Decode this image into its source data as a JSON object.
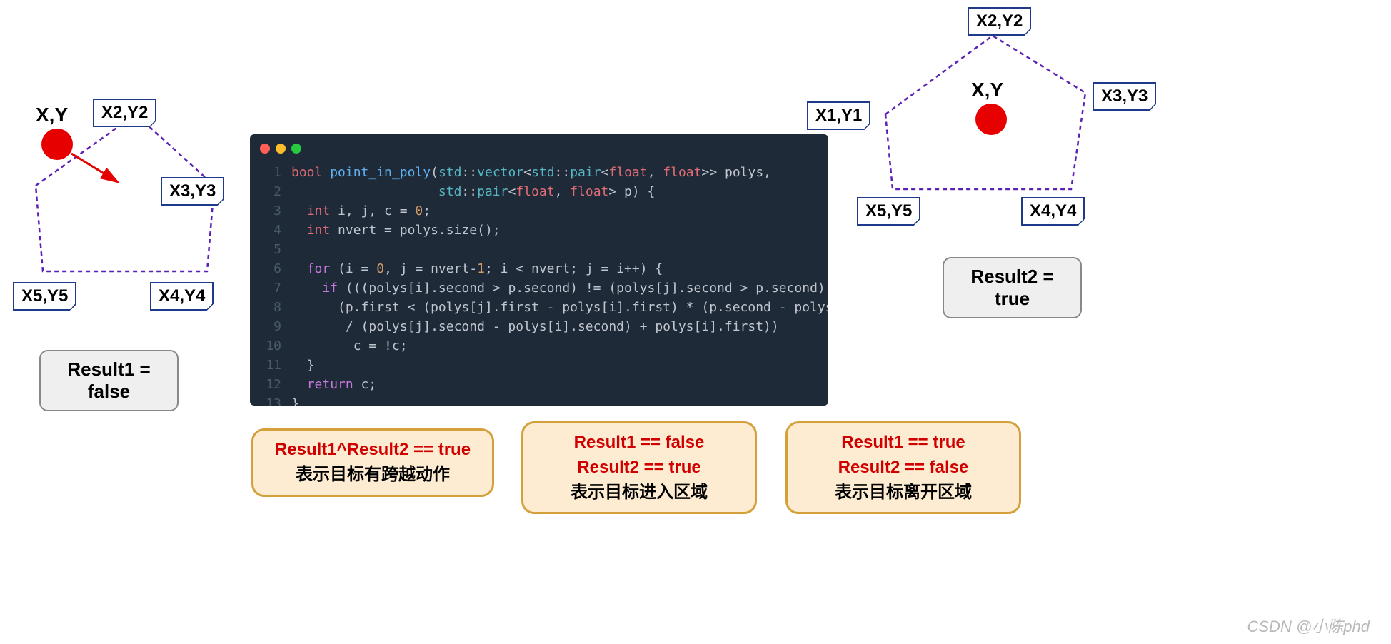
{
  "left_diagram": {
    "xy": "X,Y",
    "points": {
      "p2": "X2,Y2",
      "p3": "X3,Y3",
      "p4": "X4,Y4",
      "p5": "X5,Y5"
    }
  },
  "right_diagram": {
    "xy": "X,Y",
    "points": {
      "p1": "X1,Y1",
      "p2": "X2,Y2",
      "p3": "X3,Y3",
      "p4": "X4,Y4",
      "p5": "X5,Y5"
    }
  },
  "result1": {
    "line1": "Result1 =",
    "line2": "false"
  },
  "result2": {
    "line1": "Result2 =",
    "line2": "true"
  },
  "code": {
    "lines": [
      "bool point_in_poly(std::vector<std::pair<float, float>> polys,",
      "                   std::pair<float, float> p) {",
      "  int i, j, c = 0;",
      "  int nvert = polys.size();",
      "",
      "  for (i = 0, j = nvert-1; i < nvert; j = i++) {",
      "    if (((polys[i].second > p.second) != (polys[j].second > p.second)) &&",
      "      (p.first < (polys[j].first - polys[i].first) * (p.second - polys[i].second)",
      "       / (polys[j].second - polys[i].second) + polys[i].first))",
      "        c = !c;",
      "  }",
      "  return c;",
      "}"
    ]
  },
  "bottom": {
    "b1": {
      "title": "Result1^Result2 == true",
      "desc": "表示目标有跨越动作"
    },
    "b2": {
      "l1": "Result1 == false",
      "l2": "Result2 == true",
      "desc": "表示目标进入区域"
    },
    "b3": {
      "l1": "Result1 == true",
      "l2": "Result2 == false",
      "desc": "表示目标离开区域"
    }
  },
  "watermark": "CSDN @小陈phd"
}
